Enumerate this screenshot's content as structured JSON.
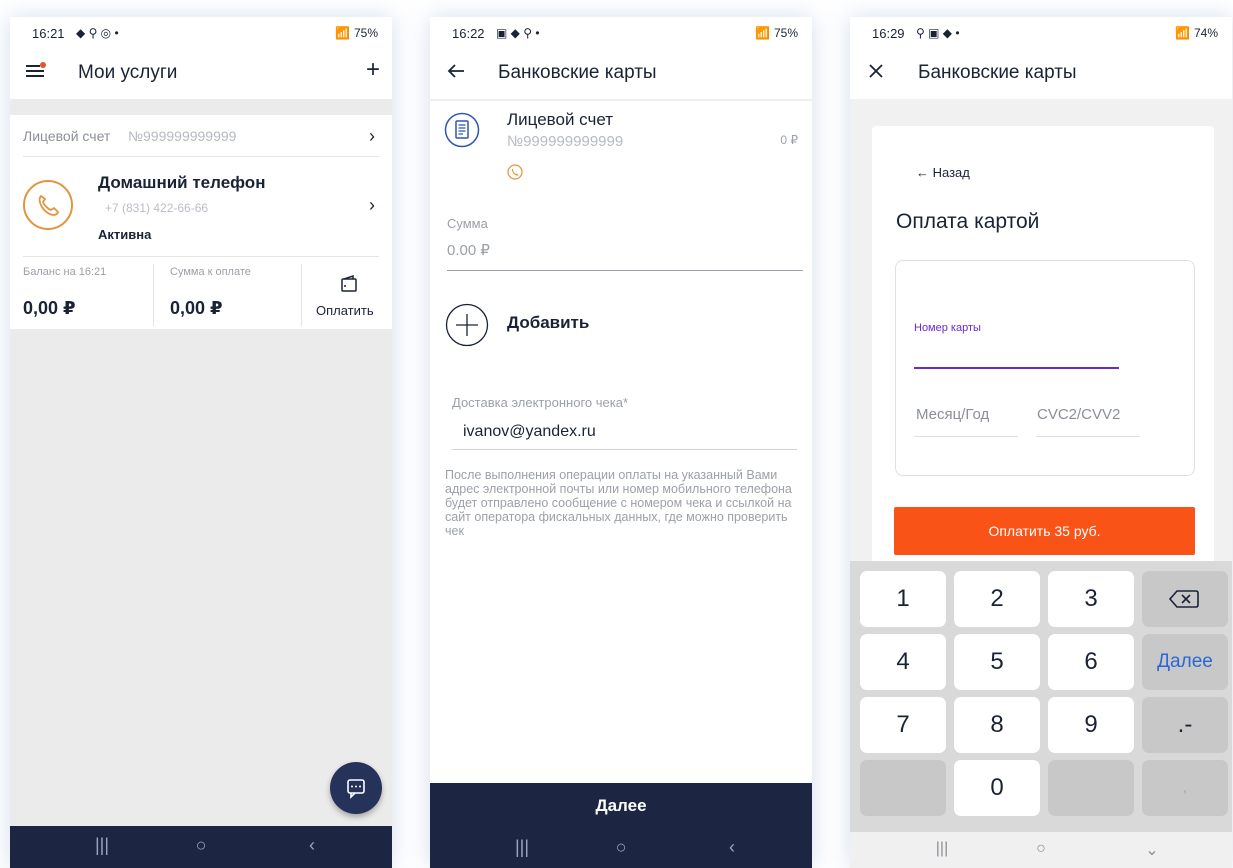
{
  "screen1": {
    "status": {
      "time": "16:21",
      "indicators": "◆ ⚲ ◎ •",
      "battery": "75%"
    },
    "header": {
      "title": "Мои услуги",
      "add": "+"
    },
    "account": {
      "label": "Лицевой счет",
      "number": "№999999999999"
    },
    "service": {
      "title": "Домашний телефон",
      "phone": "+7 (831) 422-66-66",
      "status": "Активна"
    },
    "balance": {
      "label": "Баланс на 16:21",
      "value": "0,00 ₽"
    },
    "due": {
      "label": "Сумма к оплате",
      "value": "0,00 ₽"
    },
    "pay_label": "Оплатить"
  },
  "screen2": {
    "status": {
      "time": "16:22",
      "indicators": "▣ ◆ ⚲ •",
      "battery": "75%"
    },
    "header": {
      "title": "Банковские карты"
    },
    "account": {
      "title": "Лицевой счет",
      "number": "№999999999999",
      "amount": "0 ₽"
    },
    "sum": {
      "label": "Сумма",
      "value": "0.00 ₽"
    },
    "add_label": "Добавить",
    "email": {
      "label": "Доставка электронного чека*",
      "value": "ivanov@yandex.ru"
    },
    "note": "После выполнения операции оплаты на указанный Вами адрес электронной почты или номер мобильного телефона будет отправлено сообщение с номером чека и ссылкой на сайт оператора фискальных данных, где можно проверить чек",
    "next_label": "Далее"
  },
  "screen3": {
    "status": {
      "time": "16:29",
      "indicators": "⚲ ▣ ◆ •",
      "battery": "74%"
    },
    "header": {
      "title": "Банковские карты"
    },
    "back_label": "← Назад",
    "form_title": "Оплата картой",
    "card_number_label": "Номер карты",
    "expiry_placeholder": "Месяц/Год",
    "cvc_placeholder": "CVC2/CVV2",
    "pay_button": "Оплатить 35 руб.",
    "keys": {
      "k1": "1",
      "k2": "2",
      "k3": "3",
      "k4": "4",
      "k5": "5",
      "k6": "6",
      "k7": "7",
      "k8": "8",
      "k9": "9",
      "k0": "0",
      "dot": ".-",
      "comma": ",",
      "next": "Далее"
    }
  },
  "nav": {
    "recent": "|||",
    "home": "○",
    "back": "‹",
    "hide": "⌄"
  },
  "colors": {
    "navy": "#1c2642",
    "accent_orange": "#f95317",
    "phone_orange": "#e2953f",
    "card_purple": "#6a2cc9",
    "link_blue": "#2a67d4"
  },
  "icons": [
    "menu-icon",
    "notification-dot",
    "chevron-right-icon",
    "phone-icon",
    "wallet-icon",
    "chat-icon",
    "arrow-left-icon",
    "document-icon",
    "plus-circle-icon",
    "close-icon",
    "backspace-icon"
  ]
}
